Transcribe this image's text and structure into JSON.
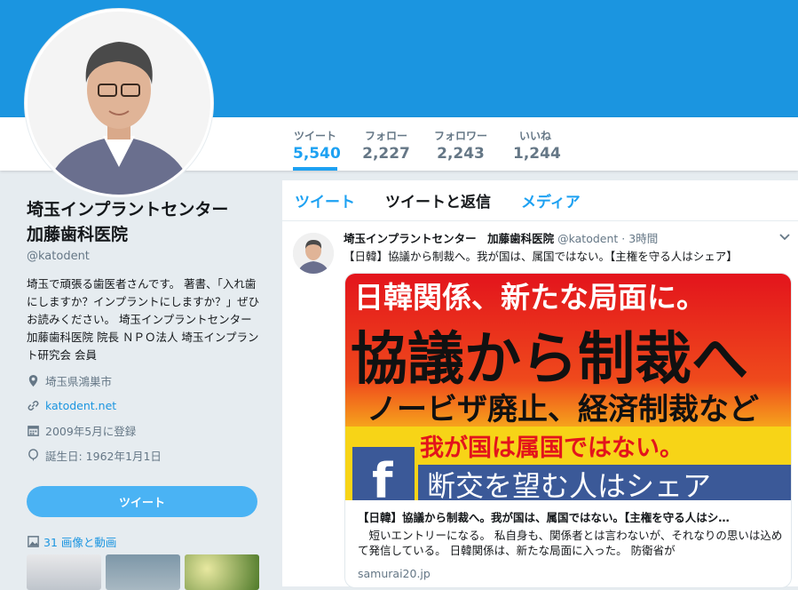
{
  "stats": [
    {
      "label": "ツイート",
      "value": "5,540"
    },
    {
      "label": "フォロー",
      "value": "2,227"
    },
    {
      "label": "フォロワー",
      "value": "2,243"
    },
    {
      "label": "いいね",
      "value": "1,244"
    }
  ],
  "profile": {
    "name": "埼玉インプラントセンター　加藤歯科医院",
    "handle": "@katodent",
    "bio": "埼玉で頑張る歯医者さんです。 著書、「入れ歯にしますか？インプラントにしますか？」ぜひお読みください。 埼玉インプラントセンター　加藤歯科医院 院長 ＮＰＯ法人 埼玉インプラント研究会 会員",
    "location": "埼玉県鴻巣市",
    "url": "katodent.net",
    "joined": "2009年5月に登録",
    "birthday": "誕生日: 1962年1月1日",
    "tweet_button": "ツイート",
    "media_label": "31 画像と動画"
  },
  "tabs": [
    "ツイート",
    "ツイートと返信",
    "メディア"
  ],
  "tweet": {
    "name": "埼玉インプラントセンター　加藤歯科医院",
    "handle": "@katodent",
    "time": "· 3時間",
    "text": "【日韓】協議から制裁へ。我が国は、属国ではない。【主権を守る人はシェア】",
    "card": {
      "img_line1": "日韓関係、新たな局面に。",
      "img_line2": "協議から制裁へ",
      "img_line3": "ノービザ廃止、経済制裁など",
      "img_line4": "我が国は属国ではない。",
      "img_line5": "断交を望む人はシェア",
      "title": "【日韓】協議から制裁へ。我が国は、属国ではない。【主権を守る人はシ…",
      "desc": "　短いエントリーになる。 私自身も、関係者とは言わないが、それなりの思いは込めて発信している。 日韓関係は、新たな局面に入った。 防衛省が",
      "url": "samurai20.jp"
    }
  },
  "colors": {
    "accent": "#1da1f2",
    "banner": "#1b95e0",
    "muted": "#657786"
  }
}
